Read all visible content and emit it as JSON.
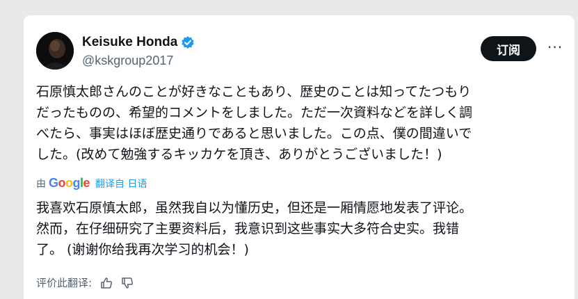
{
  "author": {
    "name": "Keisuke Honda",
    "handle": "@kskgroup2017",
    "verified_color": "#1d9bf0"
  },
  "actions": {
    "subscribe_label": "订阅",
    "more_label": "···"
  },
  "tweet": {
    "lines": [
      "石原慎太郎さんのことが好きなこともあり、歴史のことは知ってたつもり",
      "だったものの、希望的コメントをしました。ただ一次資料などを詳しく調",
      "べたら、事実はほぼ歴史通りであると思いました。この点、僕の間違いで",
      "した。(改めて勉強するキッカケを頂き、ありがとうございました！)"
    ]
  },
  "translation": {
    "by_label": "由",
    "google_letters": [
      {
        "ch": "G",
        "color": "#4285F4"
      },
      {
        "ch": "o",
        "color": "#EA4335"
      },
      {
        "ch": "o",
        "color": "#FBBC05"
      },
      {
        "ch": "g",
        "color": "#4285F4"
      },
      {
        "ch": "l",
        "color": "#34A853"
      },
      {
        "ch": "e",
        "color": "#EA4335"
      }
    ],
    "link_label": "翻译自 日语",
    "lines": [
      "我喜欢石原慎太郎，虽然我自以为懂历史，但还是一厢情愿地发表了评论。",
      "然而，在仔细研究了主要资料后，我意识到这些事实大多符合史实。我错",
      "了。 (谢谢你给我再次学习的机会！)"
    ]
  },
  "rating": {
    "label": "评价此翻译:",
    "thumbs_up_icon": "thumbs-up-icon",
    "thumbs_down_icon": "thumbs-down-icon"
  }
}
